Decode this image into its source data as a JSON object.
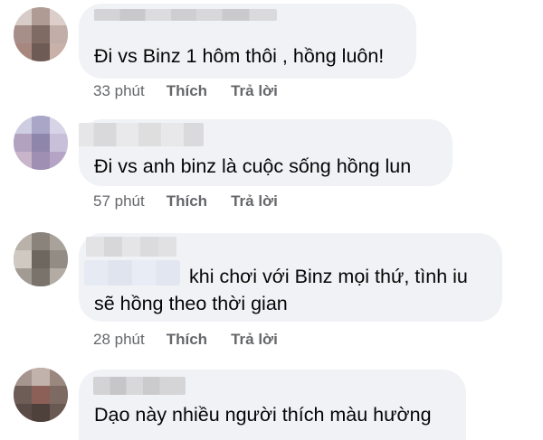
{
  "comments": [
    {
      "text": "Đi vs Binz 1 hôm thôi , hồng luôn!",
      "time": "33 phút",
      "like": "Thích",
      "reply": "Trả lời"
    },
    {
      "text": "Đi vs anh binz là cuộc sống hồng lun",
      "time": "57 phút",
      "like": "Thích",
      "reply": "Trả lời"
    },
    {
      "text_line1": "khi chơi với Binz mọi thứ, tình iu",
      "text_line2": "sẽ hồng theo thời gian",
      "time": "28 phút",
      "like": "Thích",
      "reply": "Trả lời"
    },
    {
      "text": "Dạo này nhiều người thích màu hường"
    }
  ],
  "colors": {
    "bubble": "#f0f2f5",
    "text": "#050505",
    "meta": "#65676b"
  }
}
